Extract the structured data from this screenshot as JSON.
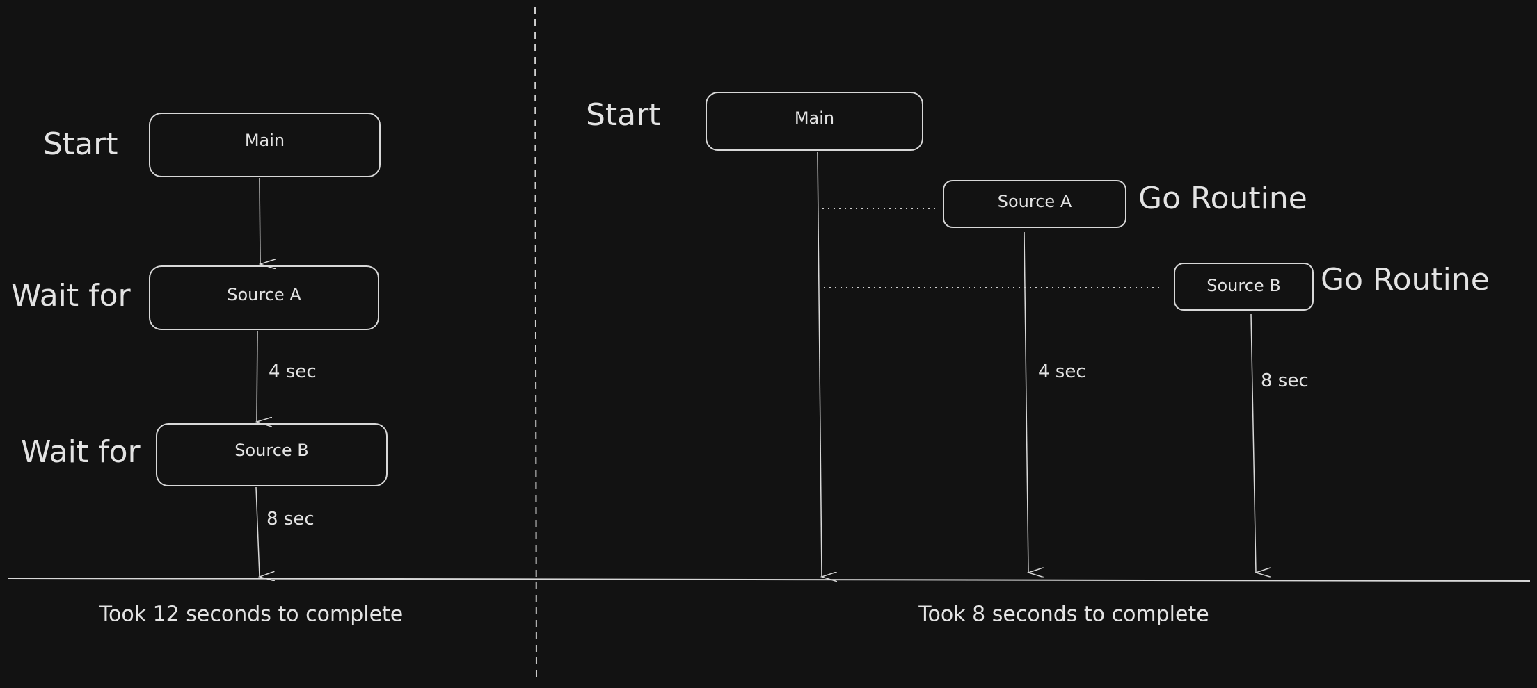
{
  "left_panel": {
    "steps": [
      {
        "label": "Start",
        "box": "Main"
      },
      {
        "label": "Wait for",
        "box": "Source A"
      },
      {
        "label": "Wait for",
        "box": "Source B"
      }
    ],
    "durations": [
      "4 sec",
      "8 sec"
    ],
    "summary": "Took 12 seconds to complete"
  },
  "right_panel": {
    "start_label": "Start",
    "main_box": "Main",
    "goroutines": [
      {
        "box": "Source A",
        "label": "Go Routine",
        "duration": "4 sec"
      },
      {
        "box": "Source B",
        "label": "Go Routine",
        "duration": "8 sec"
      }
    ],
    "summary": "Took 8 seconds to complete"
  },
  "colors": {
    "background": "#121212",
    "stroke": "#d8d8d8",
    "text": "#e3e3e3"
  }
}
